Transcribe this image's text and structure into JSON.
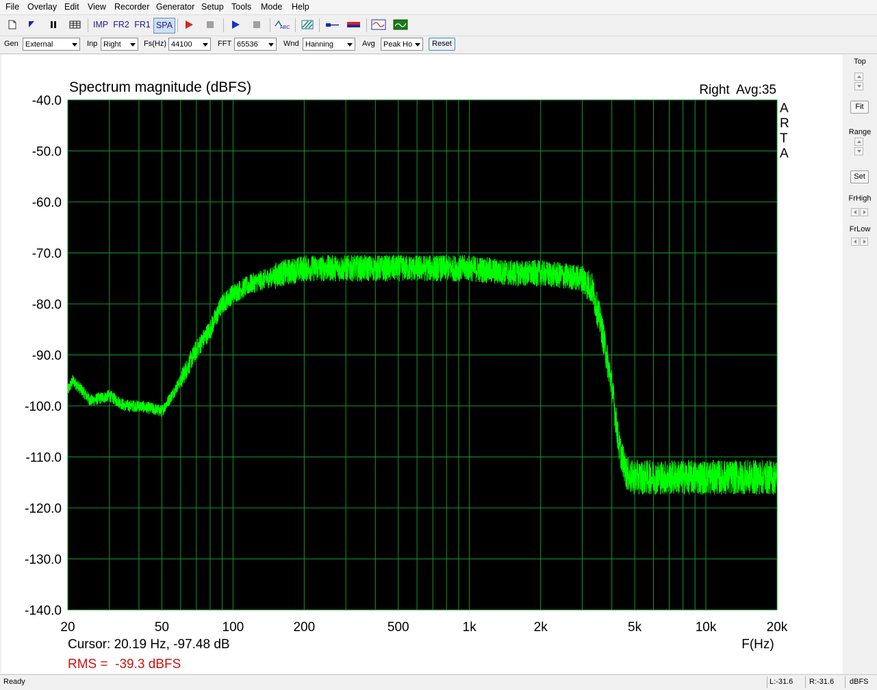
{
  "menu": [
    "File",
    "Overlay",
    "Edit",
    "View",
    "Recorder",
    "Generator",
    "Setup",
    "Tools",
    "Mode",
    "Help"
  ],
  "toolbar": {
    "imp_label": "IMP",
    "fr2_label": "FR2",
    "fr1_label": "FR1",
    "spa_label": "SPA"
  },
  "controls": {
    "gen_label": "Gen",
    "gen_value": "External",
    "inp_label": "Inp",
    "inp_value": "Right",
    "fs_label": "Fs(Hz)",
    "fs_value": "44100",
    "fft_label": "FFT",
    "fft_value": "65536",
    "wnd_label": "Wnd",
    "wnd_value": "Hanning",
    "avg_label": "Avg",
    "avg_value": "Peak Ho",
    "reset_label": "Reset"
  },
  "right_panel": {
    "top_label": "Top",
    "fit_label": "Fit",
    "range_label": "Range",
    "set_label": "Set",
    "frhigh_label": "FrHigh",
    "frlow_label": "FrLow"
  },
  "status": {
    "ready": "Ready",
    "left": "L:-31.6",
    "right": "R:-31.6",
    "units": "dBFS"
  },
  "colors": {
    "plot_bg": "#000000",
    "grid": "#159a2a",
    "trace": "#00ff00",
    "rms_text": "#d01010"
  },
  "chart_data": {
    "type": "line",
    "title": "Spectrum magnitude (dBFS)",
    "channel_info": "Right  Avg:35",
    "watermark": [
      "A",
      "R",
      "T",
      "A"
    ],
    "x_scale": "log",
    "xlim": [
      20,
      20000
    ],
    "ylim": [
      -140,
      -40
    ],
    "xlabel": "F(Hz)",
    "xticks": [
      {
        "v": 20,
        "label": "20"
      },
      {
        "v": 50,
        "label": "50"
      },
      {
        "v": 100,
        "label": "100"
      },
      {
        "v": 200,
        "label": "200"
      },
      {
        "v": 500,
        "label": "500"
      },
      {
        "v": 1000,
        "label": "1k"
      },
      {
        "v": 2000,
        "label": "2k"
      },
      {
        "v": 5000,
        "label": "5k"
      },
      {
        "v": 10000,
        "label": "10k"
      },
      {
        "v": 20000,
        "label": "20k"
      }
    ],
    "yticks": [
      {
        "v": -40,
        "label": "-40.0"
      },
      {
        "v": -50,
        "label": "-50.0"
      },
      {
        "v": -60,
        "label": "-60.0"
      },
      {
        "v": -70,
        "label": "-70.0"
      },
      {
        "v": -80,
        "label": "-80.0"
      },
      {
        "v": -90,
        "label": "-90.0"
      },
      {
        "v": -100,
        "label": "-100.0"
      },
      {
        "v": -110,
        "label": "-110.0"
      },
      {
        "v": -120,
        "label": "-120.0"
      },
      {
        "v": -130,
        "label": "-130.0"
      },
      {
        "v": -140,
        "label": "-140.0"
      }
    ],
    "grid": true,
    "series": [
      {
        "x": [
          20,
          21,
          23,
          25,
          30,
          35,
          40,
          45,
          50,
          55,
          60,
          70,
          80,
          90,
          100,
          120,
          140,
          160,
          180,
          200,
          250,
          300,
          400,
          500,
          700,
          1000,
          1500,
          2000,
          2500,
          3000,
          3300,
          3600,
          4000,
          4300,
          4600,
          4800,
          5000,
          7000,
          10000,
          15000,
          20000
        ],
        "y": [
          -97,
          -95,
          -97,
          -99,
          -98,
          -100,
          -100,
          -100.5,
          -101,
          -98,
          -95,
          -89,
          -85,
          -80,
          -78,
          -76,
          -75,
          -74,
          -73.5,
          -73,
          -73,
          -73,
          -73,
          -73,
          -73,
          -73,
          -74,
          -74,
          -74.5,
          -75,
          -77,
          -84,
          -96,
          -108,
          -113,
          -114,
          -114,
          -114,
          -114,
          -114,
          -114
        ]
      }
    ],
    "cursor_text": "Cursor: 20.19 Hz, -97.48 dB",
    "rms_text": "RMS =  -39.3 dBFS"
  }
}
